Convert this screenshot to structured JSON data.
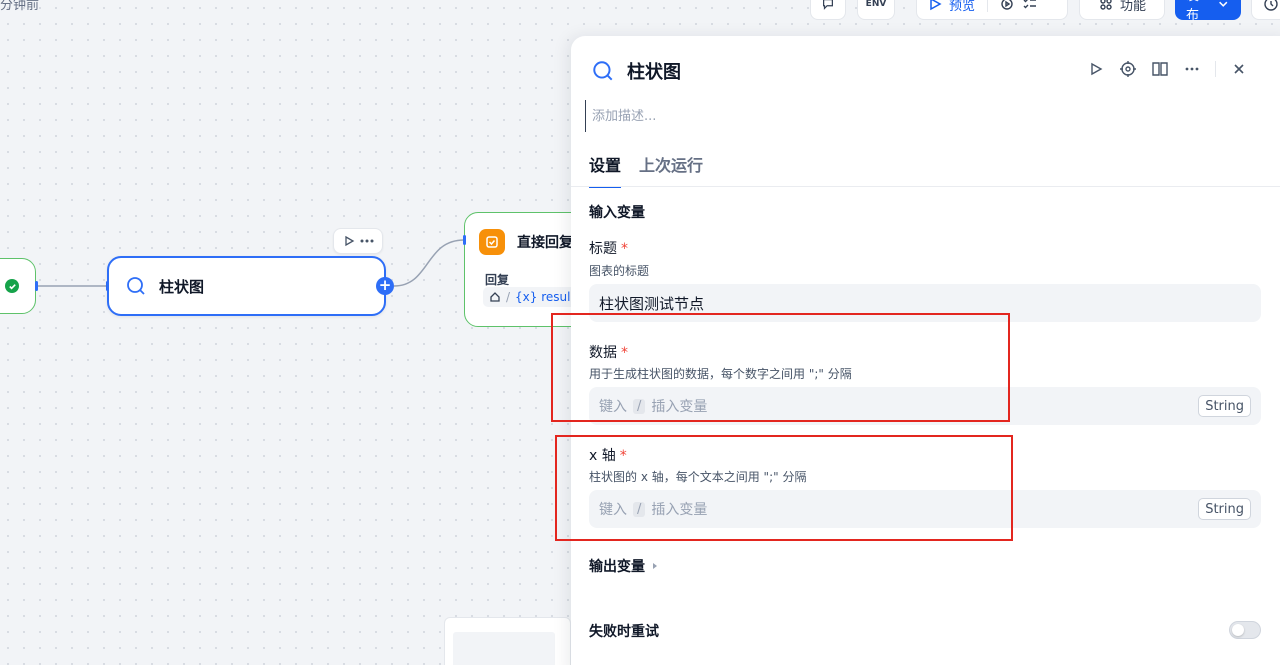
{
  "toolbar": {
    "time_ago": "分钟前",
    "env_label": "ENV",
    "preview_label": "预览",
    "features_label": "功能",
    "publish_label": "发布"
  },
  "canvas": {
    "bar_node": {
      "title": "柱状图"
    },
    "reply_node": {
      "title": "直接回复",
      "reply_label": "回复",
      "var_text": "{x} resul"
    }
  },
  "panel": {
    "title": "柱状图",
    "description_placeholder": "添加描述...",
    "tabs": [
      {
        "label": "设置",
        "active": true
      },
      {
        "label": "上次运行",
        "active": false
      }
    ],
    "input_section_title": "输入变量",
    "fields": [
      {
        "label": "标题",
        "required_mark": "*",
        "description": "图表的标题",
        "value": "柱状图测试节点"
      },
      {
        "label": "数据",
        "required_mark": "*",
        "description": "用于生成柱状图的数据，每个数字之间用 \";\" 分隔",
        "placeholder_a": "键入",
        "placeholder_slash": "/",
        "placeholder_b": "插入变量",
        "type": "String"
      },
      {
        "label": "x 轴",
        "required_mark": "*",
        "description": "柱状图的 x 轴，每个文本之间用 \";\" 分隔",
        "placeholder_a": "键入",
        "placeholder_slash": "/",
        "placeholder_b": "插入变量",
        "type": "String"
      }
    ],
    "output_section_title": "输出变量",
    "retry_label": "失败时重试",
    "retry_enabled": false
  },
  "colors": {
    "accent": "#155eef",
    "annotation": "#e3261f",
    "success": "#16a34a",
    "reply_icon": "#f79009"
  }
}
